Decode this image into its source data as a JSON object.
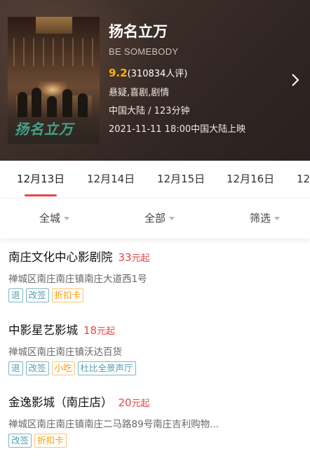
{
  "movie": {
    "title": "扬名立万",
    "english_title": "BE SOMEBODY",
    "score": "9.2",
    "rating_count": "(310834人评)",
    "genres": "悬疑,喜剧,剧情",
    "region_duration": "中国大陆 / 123分钟",
    "release": "2021-11-11 18:00中国大陆上映",
    "poster_title_art": "扬名立万"
  },
  "date_tabs": [
    {
      "label": "12月13日",
      "active": true
    },
    {
      "label": "12月14日",
      "active": false
    },
    {
      "label": "12月15日",
      "active": false
    },
    {
      "label": "12月16日",
      "active": false
    },
    {
      "label": "12",
      "active": false
    }
  ],
  "filters": [
    {
      "label": "全城"
    },
    {
      "label": "全部"
    },
    {
      "label": "筛选"
    }
  ],
  "cinemas": [
    {
      "name": "南庄文化中心影剧院",
      "price": "33",
      "price_unit": "元起",
      "address": "禅城区南庄南庄镇南庄大道西1号",
      "tags": [
        {
          "label": "退",
          "style": "blue"
        },
        {
          "label": "改签",
          "style": "blue"
        },
        {
          "label": "折扣卡",
          "style": "orange"
        }
      ]
    },
    {
      "name": "中影星艺影城",
      "price": "18",
      "price_unit": "元起",
      "address": "禅城区南庄南庄镇沃达百货",
      "tags": [
        {
          "label": "退",
          "style": "blue"
        },
        {
          "label": "改签",
          "style": "blue"
        },
        {
          "label": "小吃",
          "style": "orange"
        },
        {
          "label": "杜比全景声厅",
          "style": "blue"
        }
      ]
    },
    {
      "name": "金逸影城（南庄店）",
      "price": "20",
      "price_unit": "元起",
      "address": "禅城区南庄南庄镇南庄二马路89号南庄吉利购物...",
      "tags": [
        {
          "label": "改签",
          "style": "blue"
        },
        {
          "label": "折扣卡",
          "style": "orange"
        }
      ]
    }
  ],
  "colors": {
    "accent_red": "#e54847",
    "score_yellow": "#ffb400",
    "tag_blue": "#589daf",
    "tag_orange": "#ff9900"
  },
  "icons": {
    "next": "chevron-right-icon",
    "dropdown": "caret-down-icon"
  }
}
